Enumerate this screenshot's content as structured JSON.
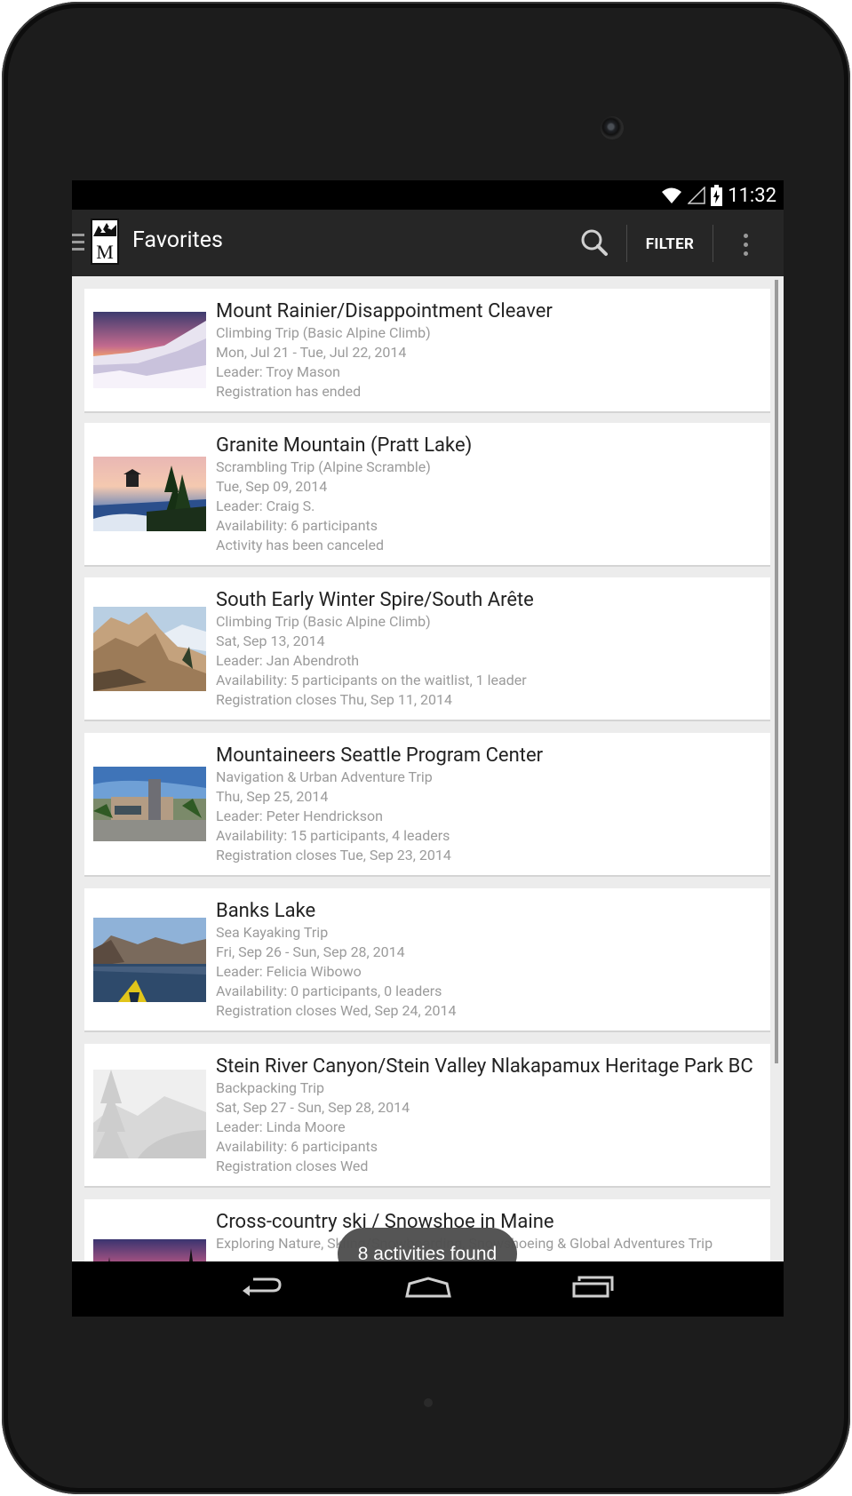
{
  "status_bar": {
    "time": "11:32",
    "icons": [
      "wifi-icon",
      "signal-icon",
      "battery-charging-icon"
    ]
  },
  "action_bar": {
    "title": "Favorites",
    "filter_label": "FILTER",
    "icons": [
      "drawer-icon",
      "app-logo",
      "search-icon",
      "overflow-menu-icon"
    ]
  },
  "colors": {
    "action_bar_bg": "#262626",
    "list_bg": "#ececec",
    "card_bg": "#ffffff",
    "toast_bg": "#505050"
  },
  "activities": [
    {
      "title": "Mount Rainier/Disappointment Cleaver",
      "lines": [
        "Climbing Trip (Basic Alpine Climb)",
        "Mon, Jul 21 - Tue, Jul 22, 2014",
        "Leader: Troy Mason",
        "Registration has ended"
      ],
      "thumbnail": "snowy-ridge-sunset-photo"
    },
    {
      "title": "Granite Mountain (Pratt Lake)",
      "lines": [
        "Scrambling Trip (Alpine Scramble)",
        "Tue, Sep 09, 2014",
        "Leader: Craig S.",
        "Availability: 6 participants",
        "Activity has been canceled"
      ],
      "thumbnail": "lookout-tower-photo"
    },
    {
      "title": "South Early Winter Spire/South Arête",
      "lines": [
        "Climbing Trip (Basic Alpine Climb)",
        "Sat, Sep 13, 2014",
        "Leader: Jan Abendroth",
        "Availability: 5 participants on the waitlist, 1 leader",
        "Registration closes Thu, Sep 11, 2014"
      ],
      "thumbnail": "granite-spire-photo"
    },
    {
      "title": "Mountaineers Seattle Program Center",
      "lines": [
        "Navigation & Urban Adventure Trip",
        "Thu, Sep 25, 2014",
        "Leader: Peter Hendrickson",
        "Availability: 15 participants, 4 leaders",
        "Registration closes Tue, Sep 23, 2014"
      ],
      "thumbnail": "program-center-building-photo"
    },
    {
      "title": "Banks Lake",
      "lines": [
        "Sea Kayaking Trip",
        "Fri, Sep 26 - Sun, Sep 28, 2014",
        "Leader: Felicia Wibowo",
        "Availability: 0 participants, 0 leaders",
        "Registration closes Wed, Sep 24, 2014"
      ],
      "thumbnail": "kayak-lake-photo"
    },
    {
      "title": "Stein River Canyon/Stein Valley Nlakapamux Heritage Park BC",
      "lines": [
        "Backpacking Trip",
        "Sat, Sep 27 - Sun, Sep 28, 2014",
        "Leader: Linda Moore",
        "Availability: 6 participants",
        "Registration closes Wed"
      ],
      "thumbnail": "placeholder-landscape-illustration"
    },
    {
      "title": "Cross-country ski / Snowshoe in Maine",
      "lines": [
        "Exploring Nature, Skiing/Snowboarding, Snowshoeing & Global Adventures Trip"
      ],
      "thumbnail": "sunset-trees-photo"
    }
  ],
  "toast": {
    "text": "8 activities found"
  },
  "nav_bar": {
    "buttons": [
      "back-icon",
      "home-icon",
      "recent-apps-icon"
    ]
  }
}
